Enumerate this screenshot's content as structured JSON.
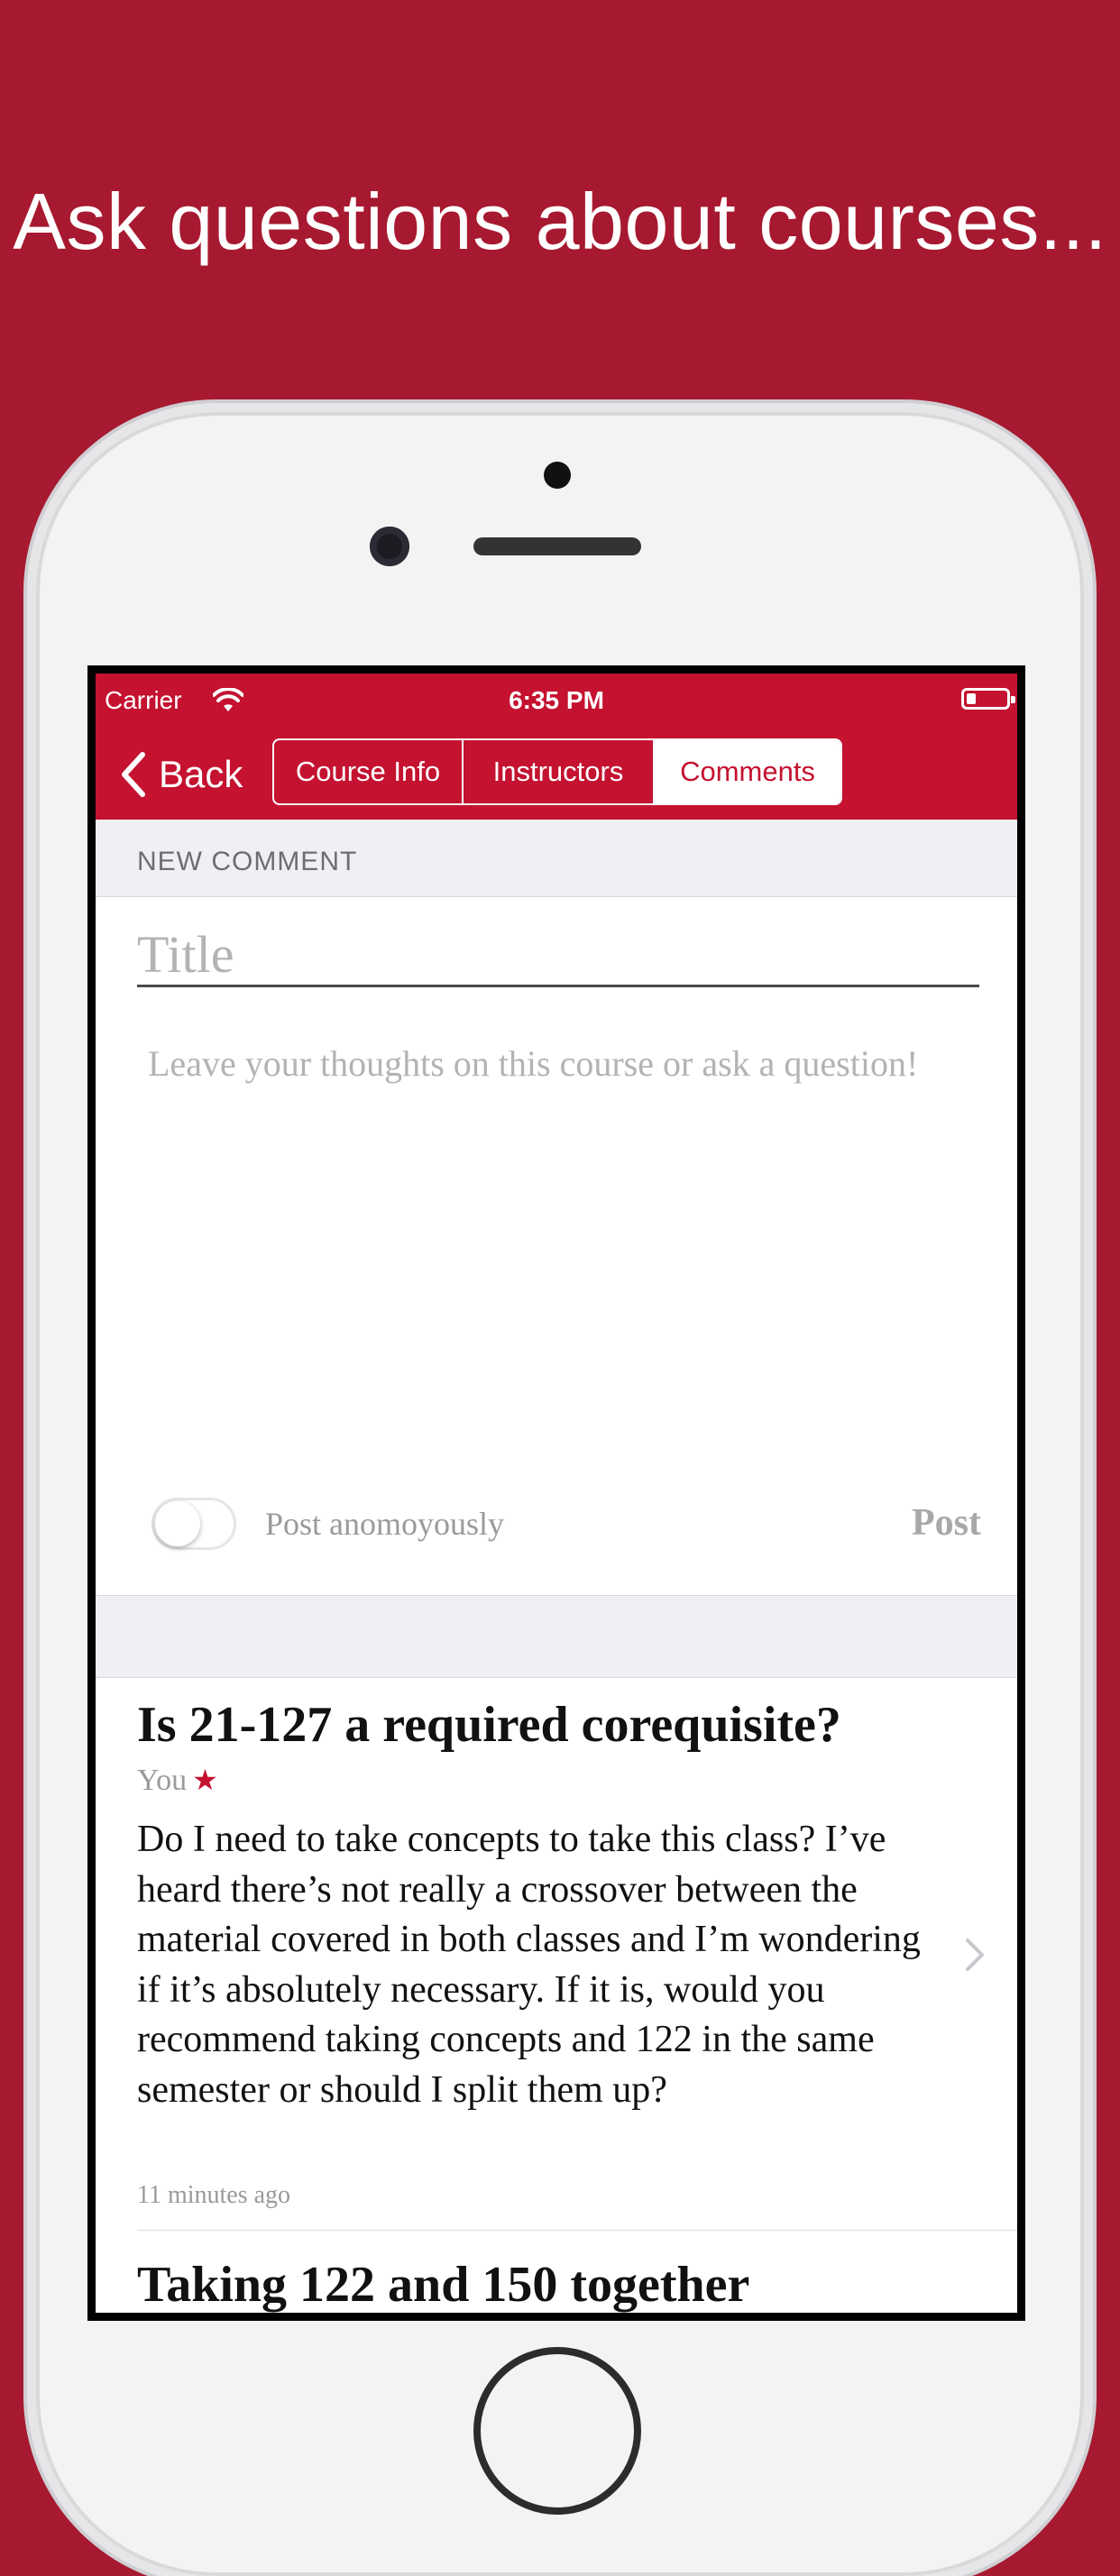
{
  "headline": "Ask questions about courses...",
  "status_bar": {
    "carrier": "Carrier",
    "time": "6:35 PM"
  },
  "nav": {
    "back_label": "Back",
    "tabs": [
      {
        "label": "Course Info",
        "selected": false
      },
      {
        "label": "Instructors",
        "selected": false
      },
      {
        "label": "Comments",
        "selected": true
      }
    ]
  },
  "new_comment": {
    "section_label": "NEW COMMENT",
    "title_placeholder": "Title",
    "body_placeholder": "Leave your thoughts on this course or ask a question!",
    "anonymous_label": "Post anomoyously",
    "anonymous_on": false,
    "post_label": "Post"
  },
  "comments": [
    {
      "title": "Is 21-127 a required corequisite?",
      "author": "You",
      "author_badge": "★",
      "body": "Do I need to take concepts to take this class?  I’ve heard there’s not really a crossover between the material covered in both classes and I’m wondering if it’s absolutely necessary.  If it is, would you recommend taking concepts and 122 in the same semester or should I split them up?",
      "time": "11 minutes ago"
    },
    {
      "title": "Taking 122 and 150 together"
    }
  ],
  "colors": {
    "brand": "#C41230",
    "background": "#A71930",
    "section_bg": "#EFEFF4"
  }
}
